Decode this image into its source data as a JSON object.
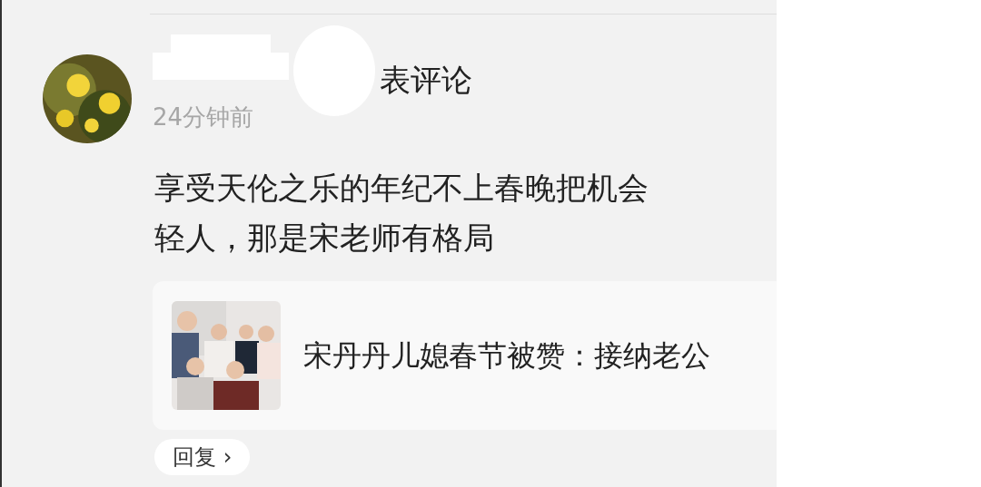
{
  "comment": {
    "header": "表评论",
    "time": "24分钟前",
    "lines": [
      "享受天伦之乐的年纪不上春晚把机会",
      "轻人，那是宋老师有格局"
    ],
    "link_card": {
      "title": "宋丹丹儿媳春节被赞：接纳老公"
    },
    "reply_button": "回复 ›"
  }
}
